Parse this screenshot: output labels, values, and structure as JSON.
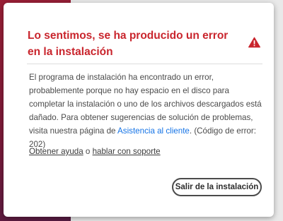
{
  "dialog": {
    "title": "Lo sentimos, se ha producido un error en la instalación",
    "body_part1": "El programa de instalación ha encontrado un error, probablemente porque no hay espacio en el disco para completar la instalación o uno de los archivos descargados está dañado. Para obtener sugerencias de solución de problemas, visita nuestra página de ",
    "support_link": "Asistencia al cliente",
    "body_part2": ". (Código de error: 202)",
    "help_link": "Obtener ayuda",
    "help_connector": " o ",
    "support_talk_link": "hablar con soporte",
    "quit_button": "Salir de la instalación"
  },
  "colors": {
    "title": "#c9252d",
    "link": "#1473e6",
    "warning_icon": "#c9252d"
  },
  "icons": {
    "warning": "warning-icon"
  }
}
